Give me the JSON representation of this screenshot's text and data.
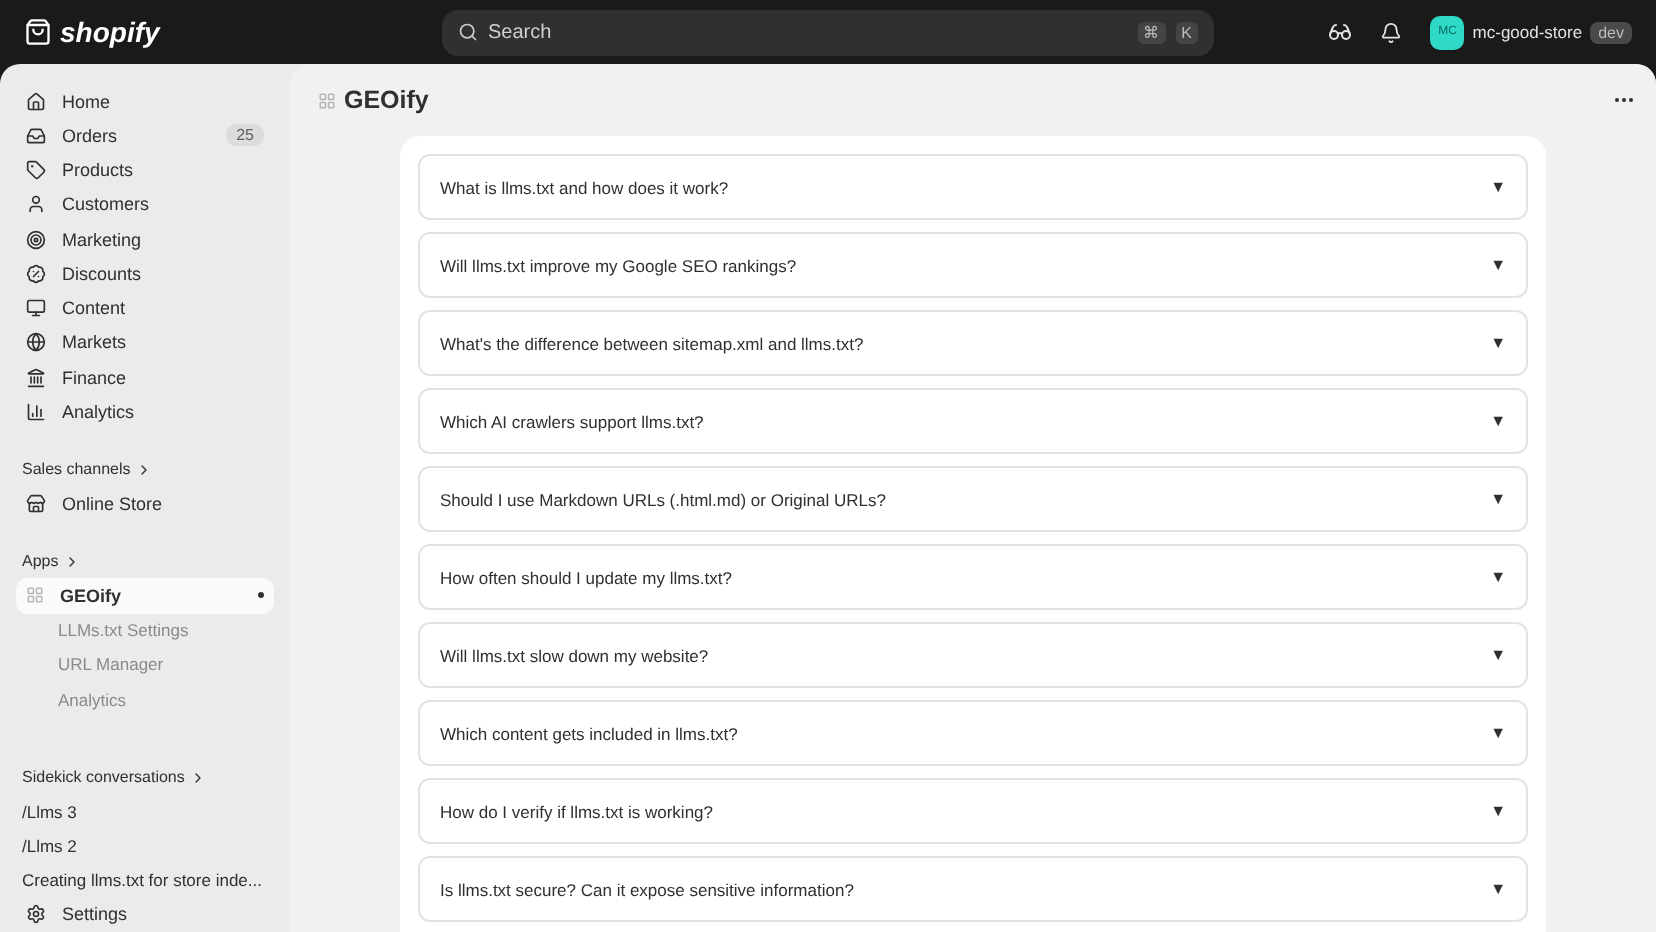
{
  "topbar": {
    "logo": "shopify",
    "search": {
      "placeholder": "Search",
      "keys": [
        "⌘",
        "K"
      ]
    },
    "store": {
      "initials": "MC",
      "name": "mc-good-store",
      "badge": "dev"
    }
  },
  "sidebar": {
    "nav": [
      {
        "label": "Home"
      },
      {
        "label": "Orders",
        "badge": "25"
      },
      {
        "label": "Products"
      },
      {
        "label": "Customers"
      },
      {
        "label": "Marketing"
      },
      {
        "label": "Discounts"
      },
      {
        "label": "Content"
      },
      {
        "label": "Markets"
      },
      {
        "label": "Finance"
      },
      {
        "label": "Analytics"
      }
    ],
    "sales_channels": {
      "title": "Sales channels",
      "items": [
        {
          "label": "Online Store"
        }
      ]
    },
    "apps": {
      "title": "Apps",
      "items": [
        {
          "label": "GEOify",
          "selected": true,
          "children": [
            {
              "label": "LLMs.txt Settings"
            },
            {
              "label": "URL Manager"
            },
            {
              "label": "Analytics"
            }
          ]
        }
      ]
    },
    "sidekick": {
      "title": "Sidekick conversations",
      "items": [
        "/Llms 3",
        "/Llms 2",
        "Creating llms.txt for store inde..."
      ]
    },
    "settings": "Settings"
  },
  "page": {
    "title": "GEOify",
    "faq": [
      {
        "question": "What is llms.txt and how does it work?",
        "toggle": "▼"
      },
      {
        "question": "Will llms.txt improve my Google SEO rankings?",
        "toggle": "▼"
      },
      {
        "question": "What's the difference between sitemap.xml and llms.txt?",
        "toggle": "▼"
      },
      {
        "question": "Which AI crawlers support llms.txt?",
        "toggle": "▼"
      },
      {
        "question": "Should I use Markdown URLs (.html.md) or Original URLs?",
        "toggle": "▼"
      },
      {
        "question": "How often should I update my llms.txt?",
        "toggle": "▼"
      },
      {
        "question": "Will llms.txt slow down my website?",
        "toggle": "▼"
      },
      {
        "question": "Which content gets included in llms.txt?",
        "toggle": "▼"
      },
      {
        "question": "How do I verify if llms.txt is working?",
        "toggle": "▼"
      },
      {
        "question": "Is llms.txt secure? Can it expose sensitive information?",
        "toggle": "▼"
      }
    ]
  }
}
